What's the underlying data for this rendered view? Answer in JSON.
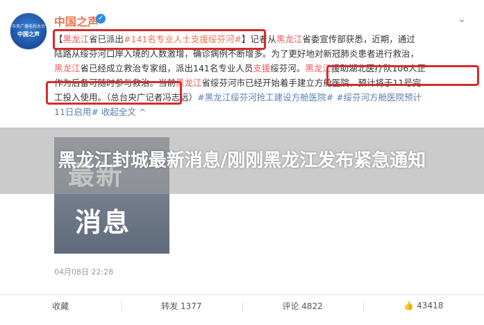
{
  "header": {
    "account_name": "中国之声",
    "avatar_small_text": "中央广播电视总台",
    "avatar_text": "中国之声",
    "verified_icon": "verified-icon",
    "more_icon": "chevron-down-icon"
  },
  "post": {
    "lines": [
      [
        "【",
        "黑龙江",
        "省已派出",
        "#141名专业人士支援绥芬河#",
        "】记者从",
        "黑龙江",
        "省委宣传部获悉，近期，通过"
      ],
      [
        "陆路从绥芬河口岸入境的人数激增，确诊病例不断增多。为了更好地对新冠肺炎患者进行救治，"
      ],
      [
        "黑龙江",
        "省已经成立救治专家组，派出141名专业人员",
        "支援",
        "绥芬河。",
        "黑龙江",
        "援助湖北医疗队106人正"
      ],
      [
        "作为后备可随时参与救治。当前",
        "黑龙江",
        "省绥芬河市已经开始着手建立方舱医院，预计将于11号完"
      ],
      [
        "工投入使用。（总台央广记者冯志远）",
        "#黑龙江绥芬河抢工建设方舱医院#",
        " ",
        "#绥芬河方舱医院预计"
      ],
      [
        "11日启用#",
        " ",
        "收起全文 ^"
      ]
    ],
    "image_text_1": "最新",
    "image_text_2": "消息",
    "date": "04月08日 22:28"
  },
  "overlay": {
    "title": "黑龙江封城最新消息/刚刚黑龙江发布紧急通知"
  },
  "footer": {
    "favorite_label": "收藏",
    "repost_label": "转发 1377",
    "comment_label": "评论 4822",
    "like_label": "43418",
    "like_icon": "thumbs-up-icon"
  },
  "colors": {
    "accent": "#eb7350",
    "highlight_box": "#d52b2b",
    "link": "#5a7fb3"
  }
}
